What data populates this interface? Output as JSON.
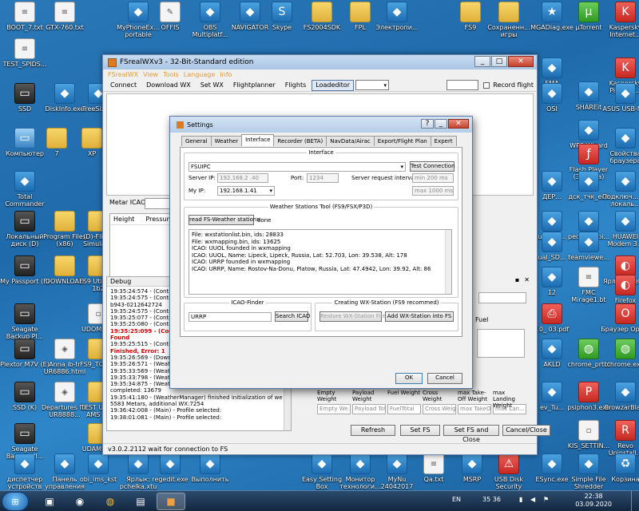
{
  "desktop": {
    "icons": [
      {
        "label": "BOOT_7.txt",
        "icon": "text-file-icon"
      },
      {
        "label": "GTX-760.txt",
        "icon": "text-file-icon"
      },
      {
        "label": "MyPhoneEx... portable",
        "icon": "app-icon"
      },
      {
        "label": "OFFIS",
        "icon": "document-icon"
      },
      {
        "label": "OBS Multiplatf...",
        "icon": "obs-icon"
      },
      {
        "label": "NAVIGATOR",
        "icon": "navigator-icon"
      },
      {
        "label": "Skype",
        "icon": "skype-icon"
      },
      {
        "label": "FS2004SDK",
        "icon": "folder-icon"
      },
      {
        "label": "FPL",
        "icon": "folder-icon"
      },
      {
        "label": "Электропи...",
        "icon": "app-icon"
      },
      {
        "label": "FS9",
        "icon": "folder-icon"
      },
      {
        "label": "Сохраненн... игры",
        "icon": "folder-icon"
      },
      {
        "label": "MGADiag.exe",
        "icon": "star-icon"
      },
      {
        "label": "µTorrent",
        "icon": "torrent-icon"
      },
      {
        "label": "Kaspersky Internet...",
        "icon": "kaspersky-icon"
      },
      {
        "label": "TEST_SPIDS...",
        "icon": "text-file-icon"
      },
      {
        "label": "EMA",
        "icon": "app-icon"
      },
      {
        "label": "SHAREit",
        "icon": "shareit-icon"
      },
      {
        "label": "Kaspersky Passwor...",
        "icon": "kaspersky-icon"
      },
      {
        "label": "SSD",
        "icon": "drive-icon"
      },
      {
        "label": "DiskInfo.exe",
        "icon": "app-icon"
      },
      {
        "label": "TreeSize...",
        "icon": "app-icon"
      },
      {
        "label": "OSI",
        "icon": "app-icon"
      },
      {
        "label": "WPS Wizard",
        "icon": "app-icon"
      },
      {
        "label": "ASUS USB-N...",
        "icon": "app-icon"
      },
      {
        "label": "Компьютер",
        "icon": "computer-icon"
      },
      {
        "label": "7",
        "icon": "folder-icon"
      },
      {
        "label": "XP",
        "icon": "folder-icon"
      },
      {
        "label": "Flash Player (32 бита)",
        "icon": "flash-icon"
      },
      {
        "label": "Свойства браузера",
        "icon": "browser-icon"
      },
      {
        "label": "Total Commander",
        "icon": "total-commander-icon"
      },
      {
        "label": "ДЕР...",
        "icon": "app-icon"
      },
      {
        "label": "дск_тчк_ест",
        "icon": "app-icon"
      },
      {
        "label": "Подключ... по локаль...",
        "icon": "network-icon"
      },
      {
        "label": "Локальный диск (D)",
        "icon": "drive-icon"
      },
      {
        "label": "Program Files (x86)",
        "icon": "folder-icon"
      },
      {
        "label": "(D)-Flight Simulat...",
        "icon": "folder-icon"
      },
      {
        "label": "ual_SD...",
        "icon": "app-icon"
      },
      {
        "label": "pedestal.bi...",
        "icon": "app-icon"
      },
      {
        "label": "HUAWEI Modem 3.0",
        "icon": "modem-icon"
      },
      {
        "label": "My Passport (F)",
        "icon": "drive-icon"
      },
      {
        "label": "DOWNLOAD",
        "icon": "folder-icon"
      },
      {
        "label": "FS9 Utilities 1b2",
        "icon": "folder-icon"
      },
      {
        "label": "ual_SD...",
        "icon": "app-icon"
      },
      {
        "label": "teamviewe...",
        "icon": "app-icon"
      },
      {
        "label": "Ярлык Firefox",
        "icon": "firefox-icon"
      },
      {
        "label": "12",
        "icon": "app-icon"
      },
      {
        "label": "FMC Mirage1.bt",
        "icon": "text-file-icon"
      },
      {
        "label": "Firefox",
        "icon": "firefox-icon"
      },
      {
        "label": "Seagate Backup Pl...",
        "icon": "drive-icon"
      },
      {
        "label": "UDOM.ICO",
        "icon": "file-icon"
      },
      {
        "label": "10_ 03.pdf",
        "icon": "pdf-icon"
      },
      {
        "label": "Браузер Opera",
        "icon": "opera-icon"
      },
      {
        "label": "Plextor M7V (E)",
        "icon": "drive-icon"
      },
      {
        "label": "Anna ib-tr UR6886.html",
        "icon": "html-icon"
      },
      {
        "label": "FS9_TOOLS",
        "icon": "folder-icon"
      },
      {
        "label": "AKLD",
        "icon": "app-icon"
      },
      {
        "label": "chrome_prtbl",
        "icon": "chrome-icon"
      },
      {
        "label": "chrome.exe",
        "icon": "chrome-icon"
      },
      {
        "label": "SSD (K)",
        "icon": "drive-icon"
      },
      {
        "label": "Departures for UR8888...",
        "icon": "html-icon"
      },
      {
        "label": "TEST UPDS AMS 78",
        "icon": "folder-icon"
      },
      {
        "label": "ev_Tu...",
        "icon": "app-icon"
      },
      {
        "label": "psiphon3.exe",
        "icon": "psiphon-icon"
      },
      {
        "label": "BrowzarBla...",
        "icon": "app-icon"
      },
      {
        "label": "Seagate Backup Pl...",
        "icon": "drive-icon"
      },
      {
        "label": "UDAMBRA",
        "icon": "folder-icon"
      },
      {
        "label": "KIS_SETTIN...",
        "icon": "file-icon"
      },
      {
        "label": "Revo Uninstall...",
        "icon": "revo-icon"
      },
      {
        "label": "диспетчер устройств",
        "icon": "device-manager-icon"
      },
      {
        "label": "Панель управления",
        "icon": "control-panel-icon"
      },
      {
        "label": "obi_ims_kst",
        "icon": "app-icon"
      },
      {
        "label": "Ярлык: pchelka.xtu",
        "icon": "shortcut-icon"
      },
      {
        "label": "regedit.exe",
        "icon": "regedit-icon"
      },
      {
        "label": "Выполнить",
        "icon": "run-icon"
      },
      {
        "label": "Easy Setting Box",
        "icon": "app-icon"
      },
      {
        "label": "Монитор технологи...",
        "icon": "app-icon"
      },
      {
        "label": "MyNu 24042017",
        "icon": "app-icon"
      },
      {
        "label": "Qa.txt",
        "icon": "text-file-icon"
      },
      {
        "label": "MSRP",
        "icon": "app-icon"
      },
      {
        "label": "USB Disk Security",
        "icon": "usb-icon"
      },
      {
        "label": "ESync.exe",
        "icon": "app-icon"
      },
      {
        "label": "Simple File Shredder",
        "icon": "shredder-icon"
      },
      {
        "label": "Корзина",
        "icon": "recycle-bin-icon"
      }
    ]
  },
  "main_window": {
    "title": "FSrealWXv3 - 32-Bit-Standard edition",
    "menu": [
      "FSrealWX",
      "View",
      "Tools",
      "Language",
      "Info"
    ],
    "toolbar": [
      "Connect",
      "Download WX",
      "Set WX",
      "Flightplanner",
      "Flights",
      "Loadeditor"
    ],
    "record_flight_label": "Record flight",
    "metar_label": "Metar ICAO:",
    "metar_headers": [
      "Height",
      "Pressure"
    ],
    "debug_title": "Debug",
    "debug_log": [
      {
        "text": "19:35:24:574 - (Contro",
        "error": false
      },
      {
        "text": "19:35:24:575 - (Contro",
        "error": false
      },
      {
        "text": "b943-0212642724",
        "error": false
      },
      {
        "text": "19:35:24:575 - (Contro",
        "error": false
      },
      {
        "text": "19:35:25:077 - (Contro",
        "error": false
      },
      {
        "text": "19:35:25:080 - (Contro",
        "error": false
      },
      {
        "text": "19:35:25:099 - (Cont",
        "error": true
      },
      {
        "text": "Found",
        "error": true
      },
      {
        "text": "19:35:25:515 - (Contro",
        "error": false
      },
      {
        "text": "Finished, Error: 1",
        "error": true
      },
      {
        "text": "19:35:26:569 - (Downl",
        "error": false
      },
      {
        "text": "19:35:26:571 - (Weat",
        "error": false
      },
      {
        "text": "19:35:33:569 - (Weat",
        "error": false
      },
      {
        "text": "19:35:33:798 - (Weat",
        "error": false
      },
      {
        "text": "19:35:34:875 - (WeatherManager) - additional weather data initialization",
        "error": false
      },
      {
        "text": "completed: 13679",
        "error": false
      },
      {
        "text": "19:35:41:180 - (WeatherManager) finished initialization of weather data:",
        "error": false
      },
      {
        "text": "5583 Metars, additional WX:7254",
        "error": false
      },
      {
        "text": "19:36:42:008 - (Main) - Profile selected:",
        "error": false
      },
      {
        "text": "19:38:01:081 - (Main) - Profile selected:",
        "error": false
      }
    ],
    "fuel_label": "Fuel",
    "weights": [
      {
        "label": "Empty Weight",
        "placeholder": "Empty We..."
      },
      {
        "label": "Payload Weight",
        "placeholder": "Payload Total"
      },
      {
        "label": "Fuel Weight",
        "placeholder": "FuelTotal"
      },
      {
        "label": "Cross Weight",
        "placeholder": "Cross Weight"
      },
      {
        "label": "max Take-Off Weight",
        "placeholder": "max TakeOff"
      },
      {
        "label": "max Landing Weight",
        "placeholder": "max Lan..."
      }
    ],
    "buttons": [
      "Refresh",
      "Set FS",
      "Set FS and Close",
      "Cancel/Close"
    ],
    "status": "v3.0.2.2112   wait for connection to FS"
  },
  "settings": {
    "title": "Settings",
    "tabs": [
      "General",
      "Weather",
      "Interface",
      "Recorder (BETA)",
      "NavData/Airac",
      "Export/Flight Plan",
      "Expert"
    ],
    "active_tab": "Interface",
    "interface_group": "Interface",
    "interface_select": "FSUIPC",
    "test_connection": "Test Connection",
    "server_ip_label": "Server IP:",
    "server_ip": "192.168.2 .40",
    "port_label": "Port:",
    "port": "1234",
    "interval_label": "Server request interval:",
    "interval_min": "min 200 ms",
    "interval_max": "max 1000 ms",
    "my_ip_label": "My IP:",
    "my_ip": "192.168.1.41",
    "weather_stations_group": "Weather Stations Tool (FS9/FSX/P3D)",
    "read_button": "read FS-Weather stations",
    "read_status": "done",
    "log": [
      "File: wxstationlist.bin, ids: 28833",
      "File: wxmapping.bin, ids: 13625",
      "ICAO: UUOL founded in wxmapping",
      "ICAO: UUOL, Name: Lipeck, Lipeck, Russia, Lat: 52.703, Lon: 39.538, Alt: 178",
      "ICAO: URRP founded in wxmapping",
      "ICAO: URRP, Name: Rostov-Na-Donu, Platow, Russia, Lat: 47.4942, Lon: 39.92, Alt: 86"
    ],
    "icao_finder_group": "ICAO-Finder",
    "icao_value": "URRP",
    "search_icao": "Search ICAO",
    "creating_group": "Creating WX-Station (FS9 recommed)",
    "restore_button": "Restore WX-Station File",
    "add_button": "Add WX-Station into FS",
    "ok": "OK",
    "cancel": "Cancel"
  },
  "taskbar": {
    "language": "EN",
    "tray_numbers": "35  36",
    "time": "22:38",
    "date": "03.09.2020"
  }
}
